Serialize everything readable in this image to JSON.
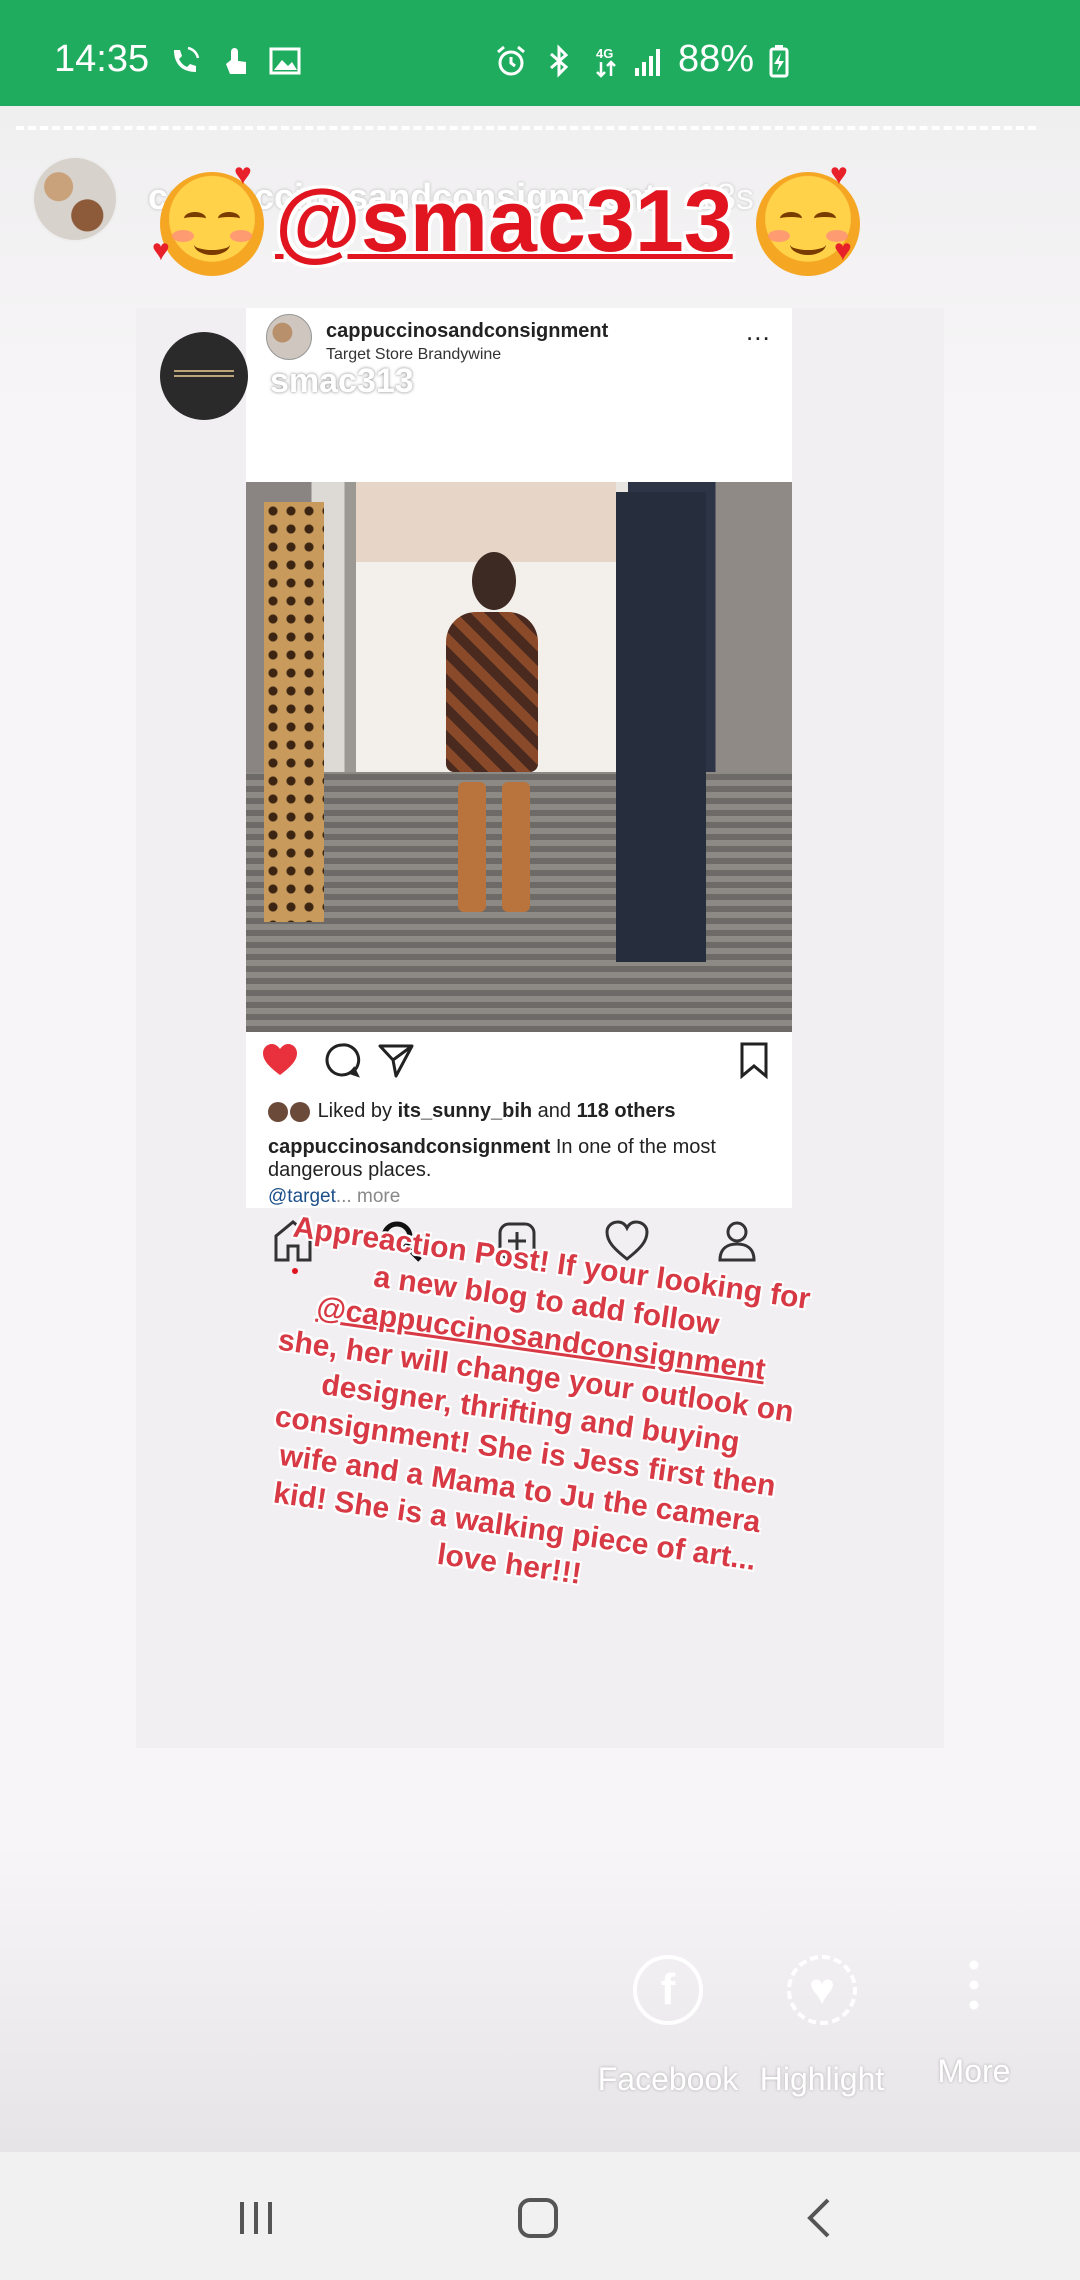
{
  "status_bar": {
    "time": "14:35",
    "battery": "88%",
    "icons": [
      "wifi-calling-icon",
      "touch-icon",
      "image-icon",
      "alarm-icon",
      "bluetooth-icon",
      "4g-data-icon",
      "signal-icon",
      "battery-charging-icon"
    ]
  },
  "story": {
    "owner": "cappuccinosandconsignment",
    "elapsed": "13s",
    "mention": "@smac313",
    "shared_username": "smac313"
  },
  "post": {
    "username": "cappuccinosandconsignment",
    "location": "Target Store Brandywine",
    "more_label": "...",
    "liked_prefix": "Liked by",
    "liked_user": "its_sunny_bih",
    "liked_middle": "and",
    "liked_others": "118 others",
    "caption_user": "cappuccinosandconsignment",
    "caption_text": "In one of the most dangerous places.",
    "caption_tag": "@target",
    "caption_more": "... more"
  },
  "note": {
    "line1": "Appreaction Post! If your looking for a new blog to add follow",
    "tag": "@cappuccinosandconsignment",
    "line2": "she, her will change your outlook on designer, thrifting and buying consignment! She is Jess first then wife and a Mama to Ju the camera kid! She is a walking piece of art... love her!!!"
  },
  "share": {
    "facebook": "Facebook",
    "highlight": "Highlight",
    "more": "More"
  },
  "colors": {
    "status_green": "#20ac5e",
    "mention_red": "#e0151f",
    "note_red": "#d73a45"
  }
}
